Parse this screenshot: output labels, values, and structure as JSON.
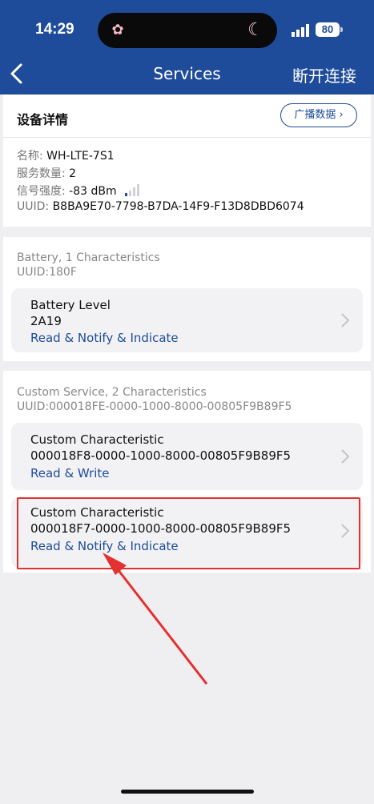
{
  "status_bar": {
    "time": "14:29",
    "battery": "80",
    "island_left_icon": "butterfly-icon",
    "island_right_icon": "moon-icon"
  },
  "nav": {
    "title": "Services",
    "right_action": "断开连接",
    "back_icon": "chevron-left-icon"
  },
  "device": {
    "section_title": "设备详情",
    "advert_button": "广播数据",
    "name_label": "名称:",
    "name_value": "WH-LTE-7S1",
    "service_count_label": "服务数量:",
    "service_count_value": "2",
    "rssi_label": "信号强度:",
    "rssi_value": "-83 dBm",
    "uuid_label": "UUID:",
    "uuid_value": "B8BA9E70-7798-B7DA-14F9-F13D8DBD6074"
  },
  "services": [
    {
      "header": "Battery, 1 Characteristics",
      "uuid": "UUID:180F",
      "characteristics": [
        {
          "name": "Battery Level",
          "uuid": "2A19",
          "props": "Read & Notify & Indicate"
        }
      ]
    },
    {
      "header": "Custom Service, 2 Characteristics",
      "uuid": "UUID:000018FE-0000-1000-8000-00805F9B89F5",
      "characteristics": [
        {
          "name": "Custom Characteristic",
          "uuid": "000018F8-0000-1000-8000-00805F9B89F5",
          "props": "Read & Write"
        },
        {
          "name": "Custom Characteristic",
          "uuid": "000018F7-0000-1000-8000-00805F9B89F5",
          "props": "Read & Notify & Indicate"
        }
      ]
    }
  ],
  "colors": {
    "header_bg": "#1e4c9a",
    "accent": "#1e4c9a",
    "annotation": "#e53030"
  }
}
